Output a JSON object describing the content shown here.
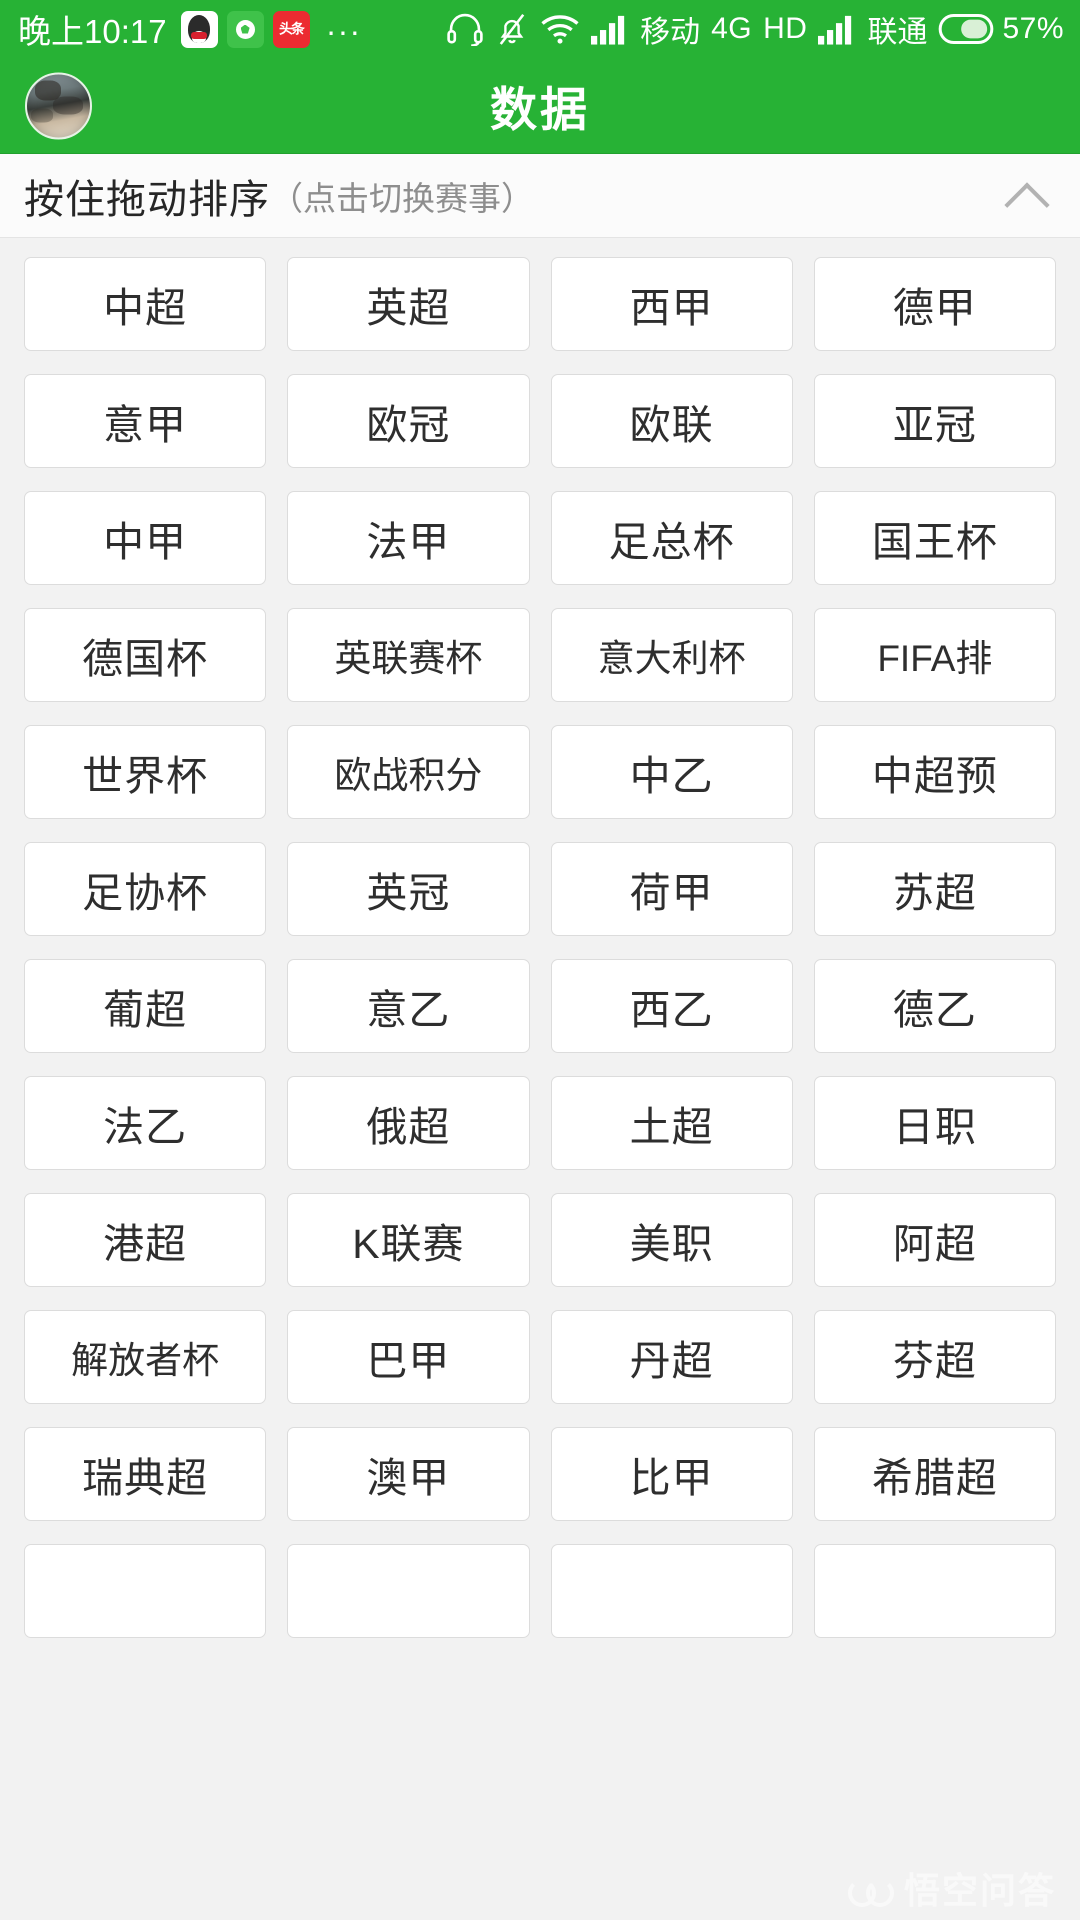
{
  "status_bar": {
    "time": "晚上10:17",
    "tray_icons": [
      {
        "name": "qq-icon",
        "label": "QQ"
      },
      {
        "name": "football-app-icon",
        "label": "球"
      },
      {
        "name": "toutiao-icon",
        "label": "头条"
      }
    ],
    "overflow": "...",
    "right_icons": [
      "headset-icon",
      "bell-muted-icon",
      "wifi-icon",
      "signal-bars-icon"
    ],
    "carrier_1": "移动",
    "network": "4G",
    "hd_label": "HD",
    "carrier_2": "联通",
    "battery_percent": "57%",
    "accent_color": "#27b235"
  },
  "app_bar": {
    "title": "数据",
    "avatar_name": "user-avatar"
  },
  "sort_header": {
    "main_text": "按住拖动排序",
    "sub_text": "（点击切换赛事）",
    "collapse_icon": "chevron-up-icon"
  },
  "leagues": {
    "rows": [
      [
        "中超",
        "英超",
        "西甲",
        "德甲"
      ],
      [
        "意甲",
        "欧冠",
        "欧联",
        "亚冠"
      ],
      [
        "中甲",
        "法甲",
        "足总杯",
        "国王杯"
      ],
      [
        "德国杯",
        "英联赛杯",
        "意大利杯",
        "FIFA排"
      ],
      [
        "世界杯",
        "欧战积分",
        "中乙",
        "中超预"
      ],
      [
        "足协杯",
        "英冠",
        "荷甲",
        "苏超"
      ],
      [
        "葡超",
        "意乙",
        "西乙",
        "德乙"
      ],
      [
        "法乙",
        "俄超",
        "土超",
        "日职"
      ],
      [
        "港超",
        "K联赛",
        "美职",
        "阿超"
      ],
      [
        "解放者杯",
        "巴甲",
        "丹超",
        "芬超"
      ],
      [
        "瑞典超",
        "澳甲",
        "比甲",
        "希腊超"
      ],
      [
        "",
        "",
        "",
        ""
      ]
    ]
  },
  "watermark": {
    "text": "悟空问答",
    "logo_name": "wukong-logo"
  }
}
